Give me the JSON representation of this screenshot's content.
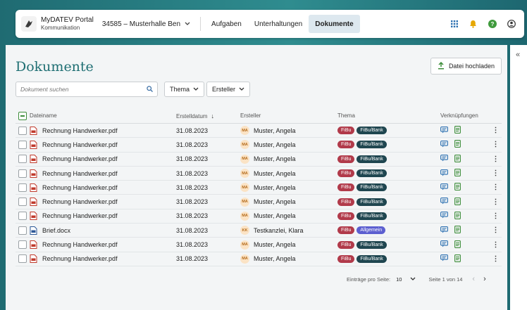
{
  "header": {
    "app_name": "MyDATEV Portal",
    "app_sub": "Kommunikation",
    "client": "34585 – Musterhalle Ben",
    "nav": [
      {
        "label": "Aufgaben",
        "active": false
      },
      {
        "label": "Unterhaltungen",
        "active": false
      },
      {
        "label": "Dokumente",
        "active": true
      }
    ],
    "icons": [
      "apps-grid-icon",
      "bell-icon",
      "help-icon",
      "user-icon"
    ]
  },
  "page": {
    "title": "Dokumente",
    "upload_label": "Datei hochladen",
    "search_placeholder": "Dokument suchen",
    "filter_thema": "Thema",
    "filter_ersteller": "Ersteller"
  },
  "table": {
    "columns": {
      "name": "Dateiname",
      "date": "Erstelldatum",
      "creator": "Ersteller",
      "thema": "Thema",
      "links": "Verknüpfungen"
    },
    "rows": [
      {
        "name": "Rechnung Handwerker.pdf",
        "type": "pdf",
        "date": "31.08.2023",
        "initials": "MA",
        "creator": "Muster, Angela",
        "tags": [
          "FiBu",
          "FiBu/Bank"
        ]
      },
      {
        "name": "Rechnung Handwerker.pdf",
        "type": "pdf",
        "date": "31.08.2023",
        "initials": "MA",
        "creator": "Muster, Angela",
        "tags": [
          "FiBu",
          "FiBu/Bank"
        ]
      },
      {
        "name": "Rechnung Handwerker.pdf",
        "type": "pdf",
        "date": "31.08.2023",
        "initials": "MA",
        "creator": "Muster, Angela",
        "tags": [
          "FiBu",
          "FiBu/Bank"
        ]
      },
      {
        "name": "Rechnung Handwerker.pdf",
        "type": "pdf",
        "date": "31.08.2023",
        "initials": "MA",
        "creator": "Muster, Angela",
        "tags": [
          "FiBu",
          "FiBu/Bank"
        ]
      },
      {
        "name": "Rechnung Handwerker.pdf",
        "type": "pdf",
        "date": "31.08.2023",
        "initials": "MA",
        "creator": "Muster, Angela",
        "tags": [
          "FiBu",
          "FiBu/Bank"
        ]
      },
      {
        "name": "Rechnung Handwerker.pdf",
        "type": "pdf",
        "date": "31.08.2023",
        "initials": "MA",
        "creator": "Muster, Angela",
        "tags": [
          "FiBu",
          "FiBu/Bank"
        ]
      },
      {
        "name": "Rechnung Handwerker.pdf",
        "type": "pdf",
        "date": "31.08.2023",
        "initials": "MA",
        "creator": "Muster, Angela",
        "tags": [
          "FiBu",
          "FiBu/Bank"
        ]
      },
      {
        "name": "Brief.docx",
        "type": "docx",
        "date": "31.08.2023",
        "initials": "KK",
        "creator": "Testkanzlei, Klara",
        "tags": [
          "FiBu",
          "Allgemein"
        ]
      },
      {
        "name": "Rechnung Handwerker.pdf",
        "type": "pdf",
        "date": "31.08.2023",
        "initials": "MA",
        "creator": "Muster, Angela",
        "tags": [
          "FiBu",
          "FiBu/Bank"
        ]
      },
      {
        "name": "Rechnung Handwerker.pdf",
        "type": "pdf",
        "date": "31.08.2023",
        "initials": "MA",
        "creator": "Muster, Angela",
        "tags": [
          "FiBu",
          "FiBu/Bank"
        ]
      }
    ]
  },
  "pagination": {
    "per_page_label": "Einträge pro Seite:",
    "per_page_value": "10",
    "page_info": "Seite 1 von 14"
  }
}
